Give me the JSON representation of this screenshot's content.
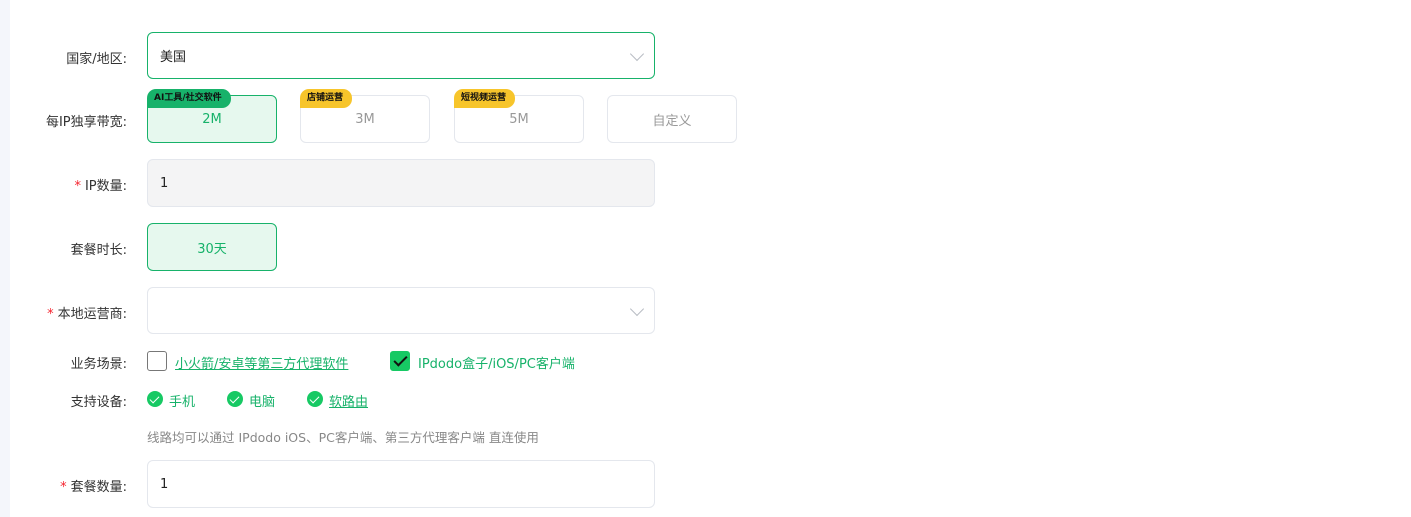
{
  "country": {
    "label": "国家/地区:",
    "value": "美国"
  },
  "bandwidth": {
    "label": "每IP独享带宽:",
    "options": [
      {
        "value": "2M",
        "tag": "AI工具/社交软件",
        "selected": true
      },
      {
        "value": "3M",
        "tag": "店铺运营",
        "selected": false
      },
      {
        "value": "5M",
        "tag": "短视频运营",
        "selected": false
      },
      {
        "value": "自定义",
        "tag": "",
        "selected": false
      }
    ]
  },
  "ip_count": {
    "required_mark": "*",
    "label": "IP数量:",
    "value": "1"
  },
  "duration": {
    "label": "套餐时长:",
    "value": "30天"
  },
  "carrier": {
    "required_mark": "*",
    "label": "本地运营商:",
    "value": ""
  },
  "scenario": {
    "label": "业务场景:",
    "options": [
      {
        "label": "小火箭/安卓等第三方代理软件",
        "checked": false
      },
      {
        "label": "IPdodo盒子/iOS/PC客户端",
        "checked": true
      }
    ]
  },
  "devices": {
    "label": "支持设备:",
    "items": [
      "手机",
      "电脑",
      "软路由"
    ],
    "hint": "线路均可以通过 IPdodo iOS、PC客户端、第三方代理客户端 直连使用"
  },
  "package_qty": {
    "required_mark": "*",
    "label": "套餐数量:",
    "value": "1"
  },
  "colors": {
    "accent": "#17b26a",
    "tag_green": "#17b26a",
    "tag_yellow": "#f7c52b",
    "required": "#f5222d"
  }
}
